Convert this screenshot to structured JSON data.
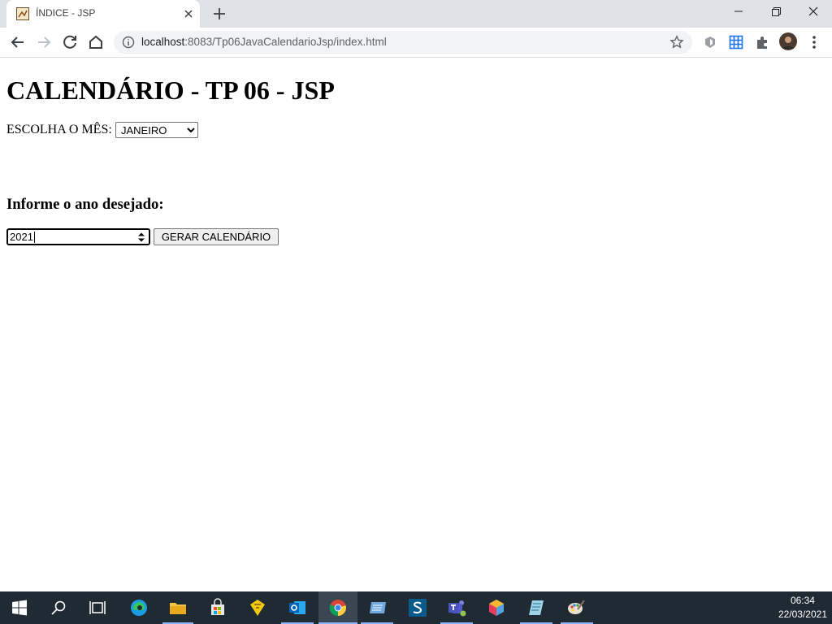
{
  "browser": {
    "tab_title": "ÍNDICE - JSP",
    "url_host": "localhost",
    "url_rest": ":8083/Tp06JavaCalendarioJsp/index.html"
  },
  "page": {
    "heading": "CALENDÁRIO - TP 06 - JSP",
    "month_label": "ESCOLHA O MÊS:",
    "month_selected": "JANEIRO",
    "year_heading": "Informe o ano desejado:",
    "year_value": "2021",
    "generate_button": "GERAR CALENDÁRIO"
  },
  "taskbar": {
    "time": "06:34",
    "date": "22/03/2021"
  }
}
